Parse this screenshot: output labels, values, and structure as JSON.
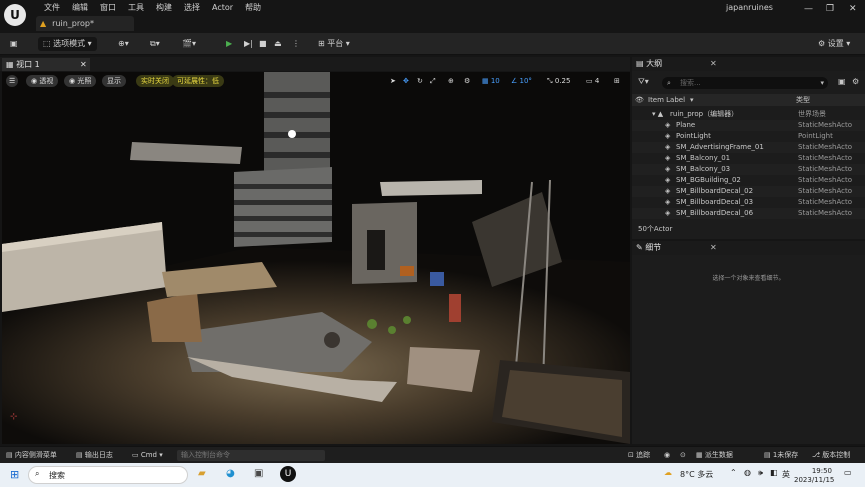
{
  "app": {
    "logo": "U",
    "menu": [
      "文件",
      "编辑",
      "窗口",
      "工具",
      "构建",
      "选择",
      "Actor",
      "帮助"
    ],
    "file_tab": "ruin_prop*",
    "project": "japanruines",
    "win": {
      "min": "—",
      "max": "❐",
      "close": "✕"
    }
  },
  "toolbar": {
    "mode": "选项模式",
    "platform": "平台",
    "settings": "设置"
  },
  "viewport": {
    "tab": "视口 1",
    "perspective": "透视",
    "lit": "光照",
    "show": "显示",
    "realtime": "实时关闭",
    "scalability": "可延展性：低",
    "grid": "10",
    "angle": "10°",
    "scale": "0.25",
    "cam": "4"
  },
  "outliner": {
    "tab": "大纲",
    "search_placeholder": "搜索...",
    "col_label": "Item Label",
    "col_type": "类型",
    "rows": [
      {
        "name": "ruin_prop（编辑器）",
        "type": "世界场景",
        "indent": 0
      },
      {
        "name": "Plane",
        "type": "StaticMeshActo",
        "indent": 1
      },
      {
        "name": "PointLight",
        "type": "PointLight",
        "indent": 1
      },
      {
        "name": "SM_AdvertisingFrame_01",
        "type": "StaticMeshActo",
        "indent": 1
      },
      {
        "name": "SM_Balcony_01",
        "type": "StaticMeshActo",
        "indent": 1
      },
      {
        "name": "SM_Balcony_03",
        "type": "StaticMeshActo",
        "indent": 1
      },
      {
        "name": "SM_BGBuilding_02",
        "type": "StaticMeshActo",
        "indent": 1
      },
      {
        "name": "SM_BillboardDecal_02",
        "type": "StaticMeshActo",
        "indent": 1
      },
      {
        "name": "SM_BillboardDecal_03",
        "type": "StaticMeshActo",
        "indent": 1
      },
      {
        "name": "SM_BillboardDecal_06",
        "type": "StaticMeshActo",
        "indent": 1
      }
    ],
    "count": "50个Actor"
  },
  "details": {
    "tab": "细节",
    "empty": "选择一个对象来查看细节。"
  },
  "bottom": {
    "content": "内容侧滑菜单",
    "log": "输出日志",
    "cmd": "Cmd",
    "cmd_placeholder": "输入控制台命令",
    "trace": "追踪",
    "derived": "派生数据",
    "unsaved": "1未保存",
    "version": "版本控制"
  },
  "taskbar": {
    "search": "搜索",
    "weather": "8°C 多云",
    "ime": "英",
    "time": "19:50",
    "date": "2023/11/15"
  }
}
